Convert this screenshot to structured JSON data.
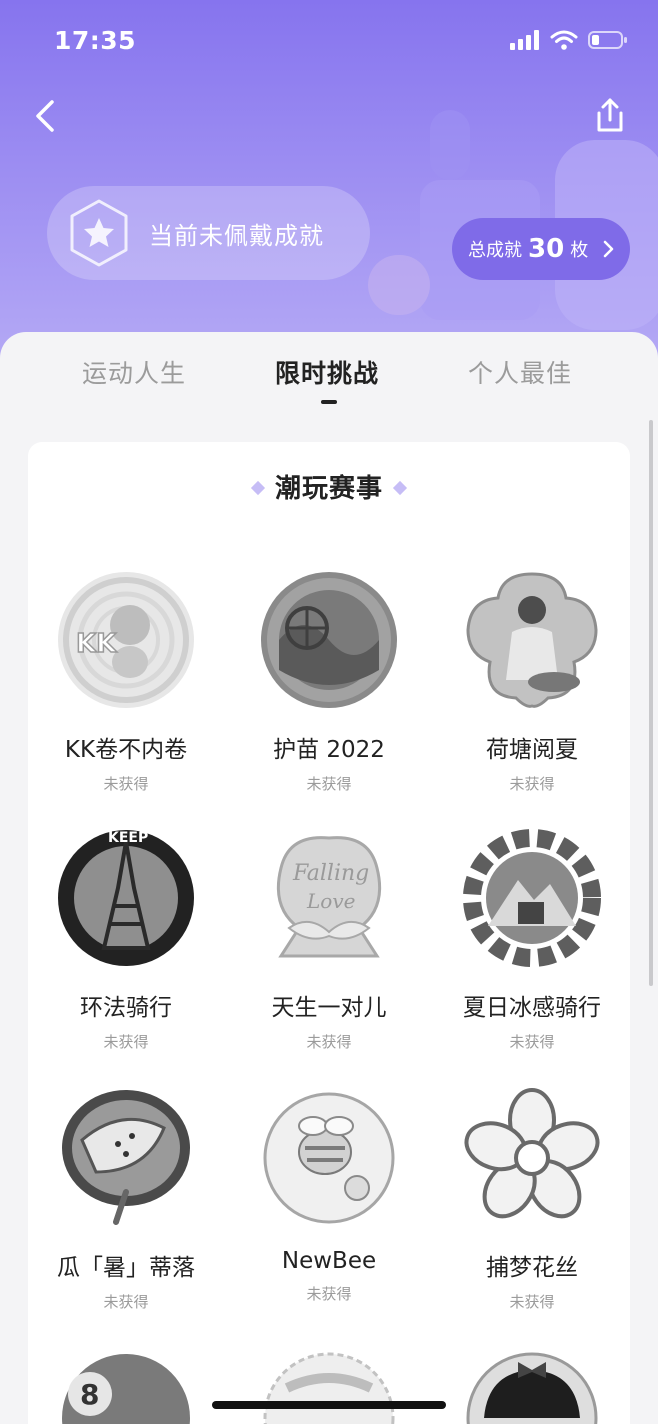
{
  "status": {
    "time": "17:35"
  },
  "header": {
    "current_badge_text": "当前未佩戴成就",
    "total_label": "总成就",
    "total_count": "30",
    "total_unit": "枚"
  },
  "tabs": [
    {
      "label": "运动人生",
      "active": false
    },
    {
      "label": "限时挑战",
      "active": true
    },
    {
      "label": "个人最佳",
      "active": false
    }
  ],
  "section": {
    "title": "潮玩赛事"
  },
  "badges": [
    {
      "name": "KK卷不内卷",
      "status": "未获得",
      "icon": "kk-medal-icon"
    },
    {
      "name": "护苗 2022",
      "status": "未获得",
      "icon": "youth-sports-medal-icon"
    },
    {
      "name": "荷塘阅夏",
      "status": "未获得",
      "icon": "lotus-lady-medal-icon"
    },
    {
      "name": "环法骑行",
      "status": "未获得",
      "icon": "eiffel-tower-medal-icon"
    },
    {
      "name": "天生一对儿",
      "status": "未获得",
      "icon": "falling-in-love-medal-icon"
    },
    {
      "name": "夏日冰感骑行",
      "status": "未获得",
      "icon": "gear-mountain-medal-icon"
    },
    {
      "name": "瓜「暑」蒂落",
      "status": "未获得",
      "icon": "watermelon-fan-medal-icon"
    },
    {
      "name": "NewBee",
      "status": "未获得",
      "icon": "bee-medal-icon"
    },
    {
      "name": "捕梦花丝",
      "status": "未获得",
      "icon": "flower-medal-icon"
    }
  ],
  "colors": {
    "accent": "#8674ee",
    "accent_dark": "#7f6be8",
    "text": "#222222",
    "muted": "#9b9b9b"
  }
}
